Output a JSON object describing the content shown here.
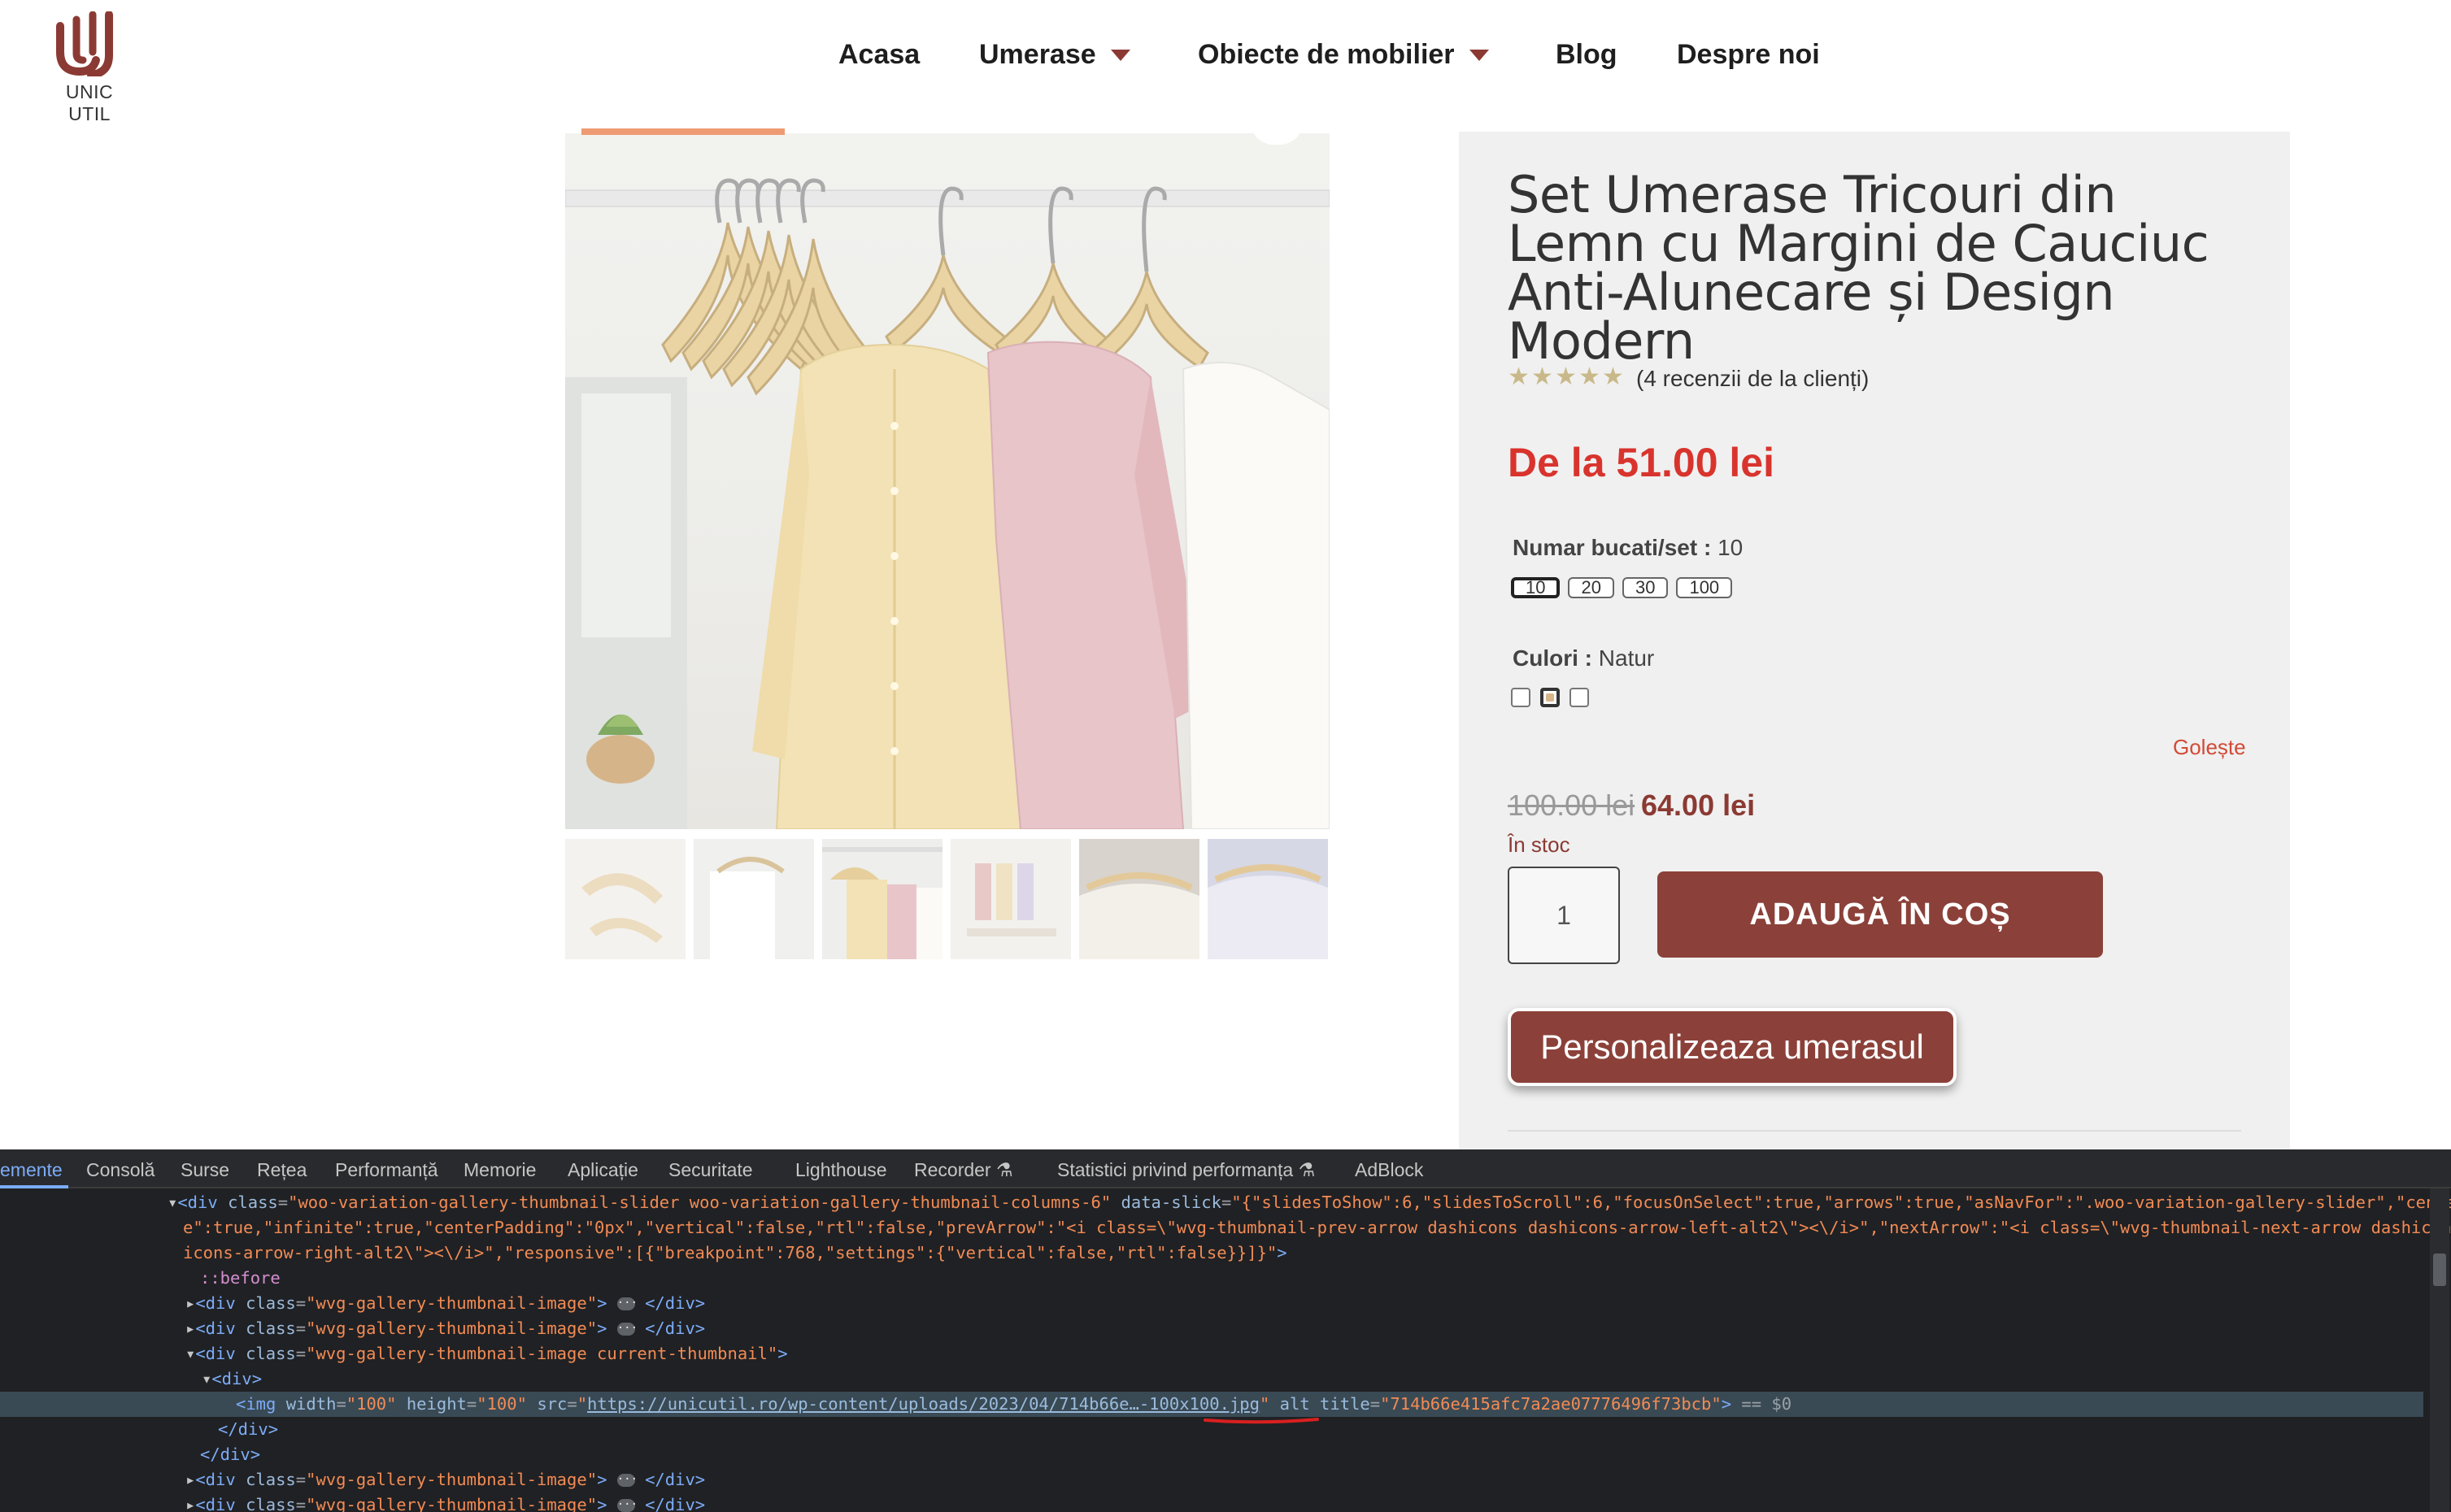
{
  "brand": {
    "logo_text": "UNIC UTIL",
    "accent_color": "#8b3a33"
  },
  "nav": {
    "items": [
      {
        "label": "Acasa",
        "has_dropdown": false
      },
      {
        "label": "Umerase",
        "has_dropdown": true
      },
      {
        "label": "Obiecte de mobilier",
        "has_dropdown": true
      },
      {
        "label": "Blog",
        "has_dropdown": false
      },
      {
        "label": "Despre noi",
        "has_dropdown": false
      }
    ]
  },
  "product": {
    "title": "Set Umerase Tricouri din Lemn cu Margini de Cauciuc Anti-Alunecare și Design Modern",
    "rating": 5,
    "reviews_text": "(4 recenzii de la clienți)",
    "price_range": "De la 51.00 lei",
    "attributes": {
      "size_label": "Numar bucati/set",
      "size_value": "10",
      "size_options": [
        "10",
        "20",
        "30",
        "100"
      ],
      "size_selected": "10",
      "color_label": "Culori",
      "color_value": "Natur",
      "color_swatch_count": 3,
      "color_selected_index": 1,
      "separator": ":"
    },
    "reset_label": "Golește",
    "old_price": "100.00 lei",
    "new_price": "64.00 lei",
    "stock_text": "În stoc",
    "quantity": "1",
    "add_to_cart_label": "ADAUGĂ ÎN COȘ",
    "personalize_label": "Personalizeaza umerasul",
    "thumbnail_count": 6,
    "current_thumbnail_index": 2
  },
  "devtools": {
    "tabs": [
      {
        "label": "emente",
        "active": true
      },
      {
        "label": "Consolă",
        "active": false
      },
      {
        "label": "Surse",
        "active": false
      },
      {
        "label": "Rețea",
        "active": false
      },
      {
        "label": "Performanță",
        "active": false
      },
      {
        "label": "Memorie",
        "active": false
      },
      {
        "label": "Aplicație",
        "active": false
      },
      {
        "label": "Securitate",
        "active": false
      },
      {
        "label": "Lighthouse",
        "active": false
      },
      {
        "label": "Recorder ⚗",
        "active": false
      },
      {
        "label": "Statistici privind performanța ⚗",
        "active": false
      },
      {
        "label": "AdBlock",
        "active": false
      }
    ],
    "slider_class": "woo-variation-gallery-thumbnail-slider woo-variation-gallery-thumbnail-columns-6",
    "data_slick_1": "{\"slidesToShow\":6,\"slidesToScroll\":6,\"focusOnSelect\":true,\"arrows\":true,\"asNavFor\":\".woo-variation-gallery-slider\",\"centerMod",
    "data_slick_2": "e\":true,\"infinite\":true,\"centerPadding\":\"0px\",\"vertical\":false,\"rtl\":false,\"prevArrow\":\"<i class=\\\"wvg-thumbnail-prev-arrow dashicons dashicons-arrow-left-alt2\\\"><\\/i>\",\"nextArrow\":\"<i class=\\\"wvg-thumbnail-next-arrow dashicons dash",
    "data_slick_3": "icons-arrow-right-alt2\\\"><\\/i>\",\"responsive\":[{\"breakpoint\":768,\"settings\":{\"vertical\":false,\"rtl\":false}}]}",
    "pseudo_before": "::before",
    "thumb_class": "wvg-gallery-thumbnail-image",
    "thumb_current_class": "wvg-gallery-thumbnail-image current-thumbnail",
    "img_width": "100",
    "img_height": "100",
    "img_src": "https://unicutil.ro/wp-content/uploads/2023/04/714b66e…-100x100.jpg",
    "img_title": "714b66e415afc7a2ae07776496f73bcb",
    "selected_marker": "== $0"
  }
}
